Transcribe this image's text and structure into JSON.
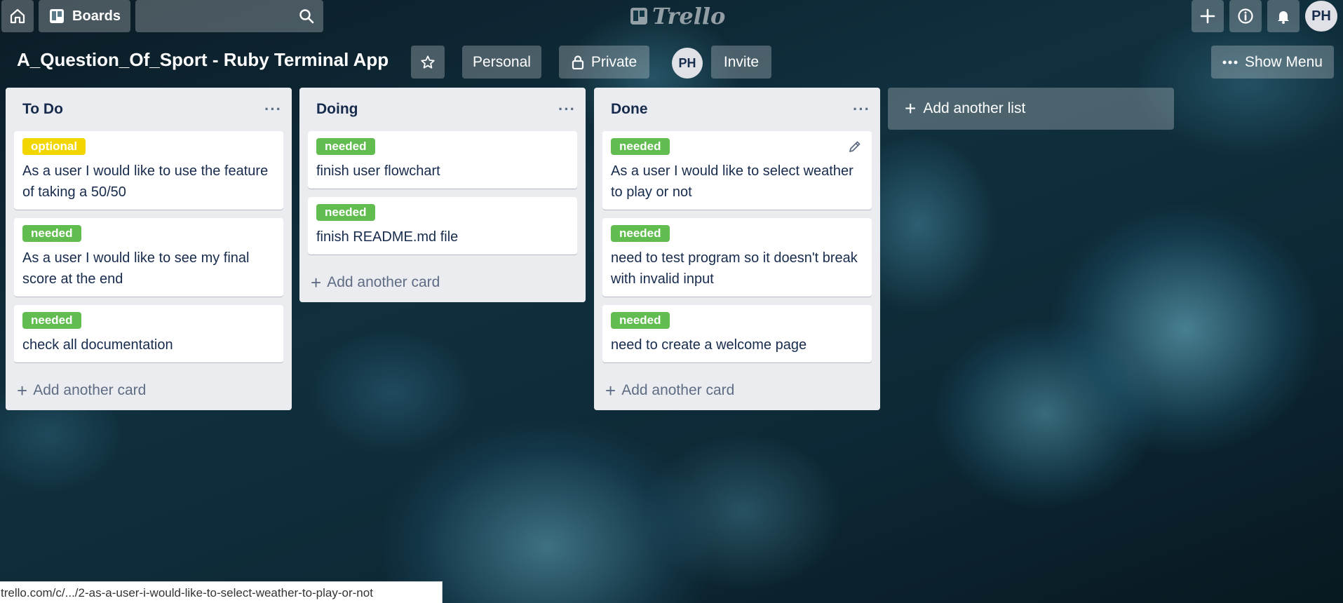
{
  "nav": {
    "boards_label": "Boards",
    "logo_text": "Trello",
    "avatar_initials": "PH"
  },
  "board": {
    "title": "A_Question_Of_Sport - Ruby Terminal App",
    "visibility_team": "Personal",
    "visibility": "Private",
    "member_initials": "PH",
    "invite_label": "Invite",
    "menu_label": "Show Menu",
    "add_list_label": "Add another list"
  },
  "label_colors": {
    "optional": "#f2d600",
    "needed": "#61bd4f"
  },
  "lists": [
    {
      "title": "To Do",
      "add_card_label": "Add another card",
      "cards": [
        {
          "label": "optional",
          "text": "As a user I would like to use the feature of taking a 50/50"
        },
        {
          "label": "needed",
          "text": "As a user I would like to see my final score at the end"
        },
        {
          "label": "needed",
          "text": "check all documentation"
        }
      ]
    },
    {
      "title": "Doing",
      "add_card_label": "Add another card",
      "cards": [
        {
          "label": "needed",
          "text": "finish user flowchart"
        },
        {
          "label": "needed",
          "text": "finish README.md file"
        }
      ]
    },
    {
      "title": "Done",
      "add_card_label": "Add another card",
      "cards": [
        {
          "label": "needed",
          "text": "As a user I would like to select weather to play or not"
        },
        {
          "label": "needed",
          "text": "need to test program so it doesn't break with invalid input"
        },
        {
          "label": "needed",
          "text": "need to create a welcome page"
        }
      ]
    }
  ],
  "status_url": "trello.com/c/.../2-as-a-user-i-would-like-to-select-weather-to-play-or-not"
}
